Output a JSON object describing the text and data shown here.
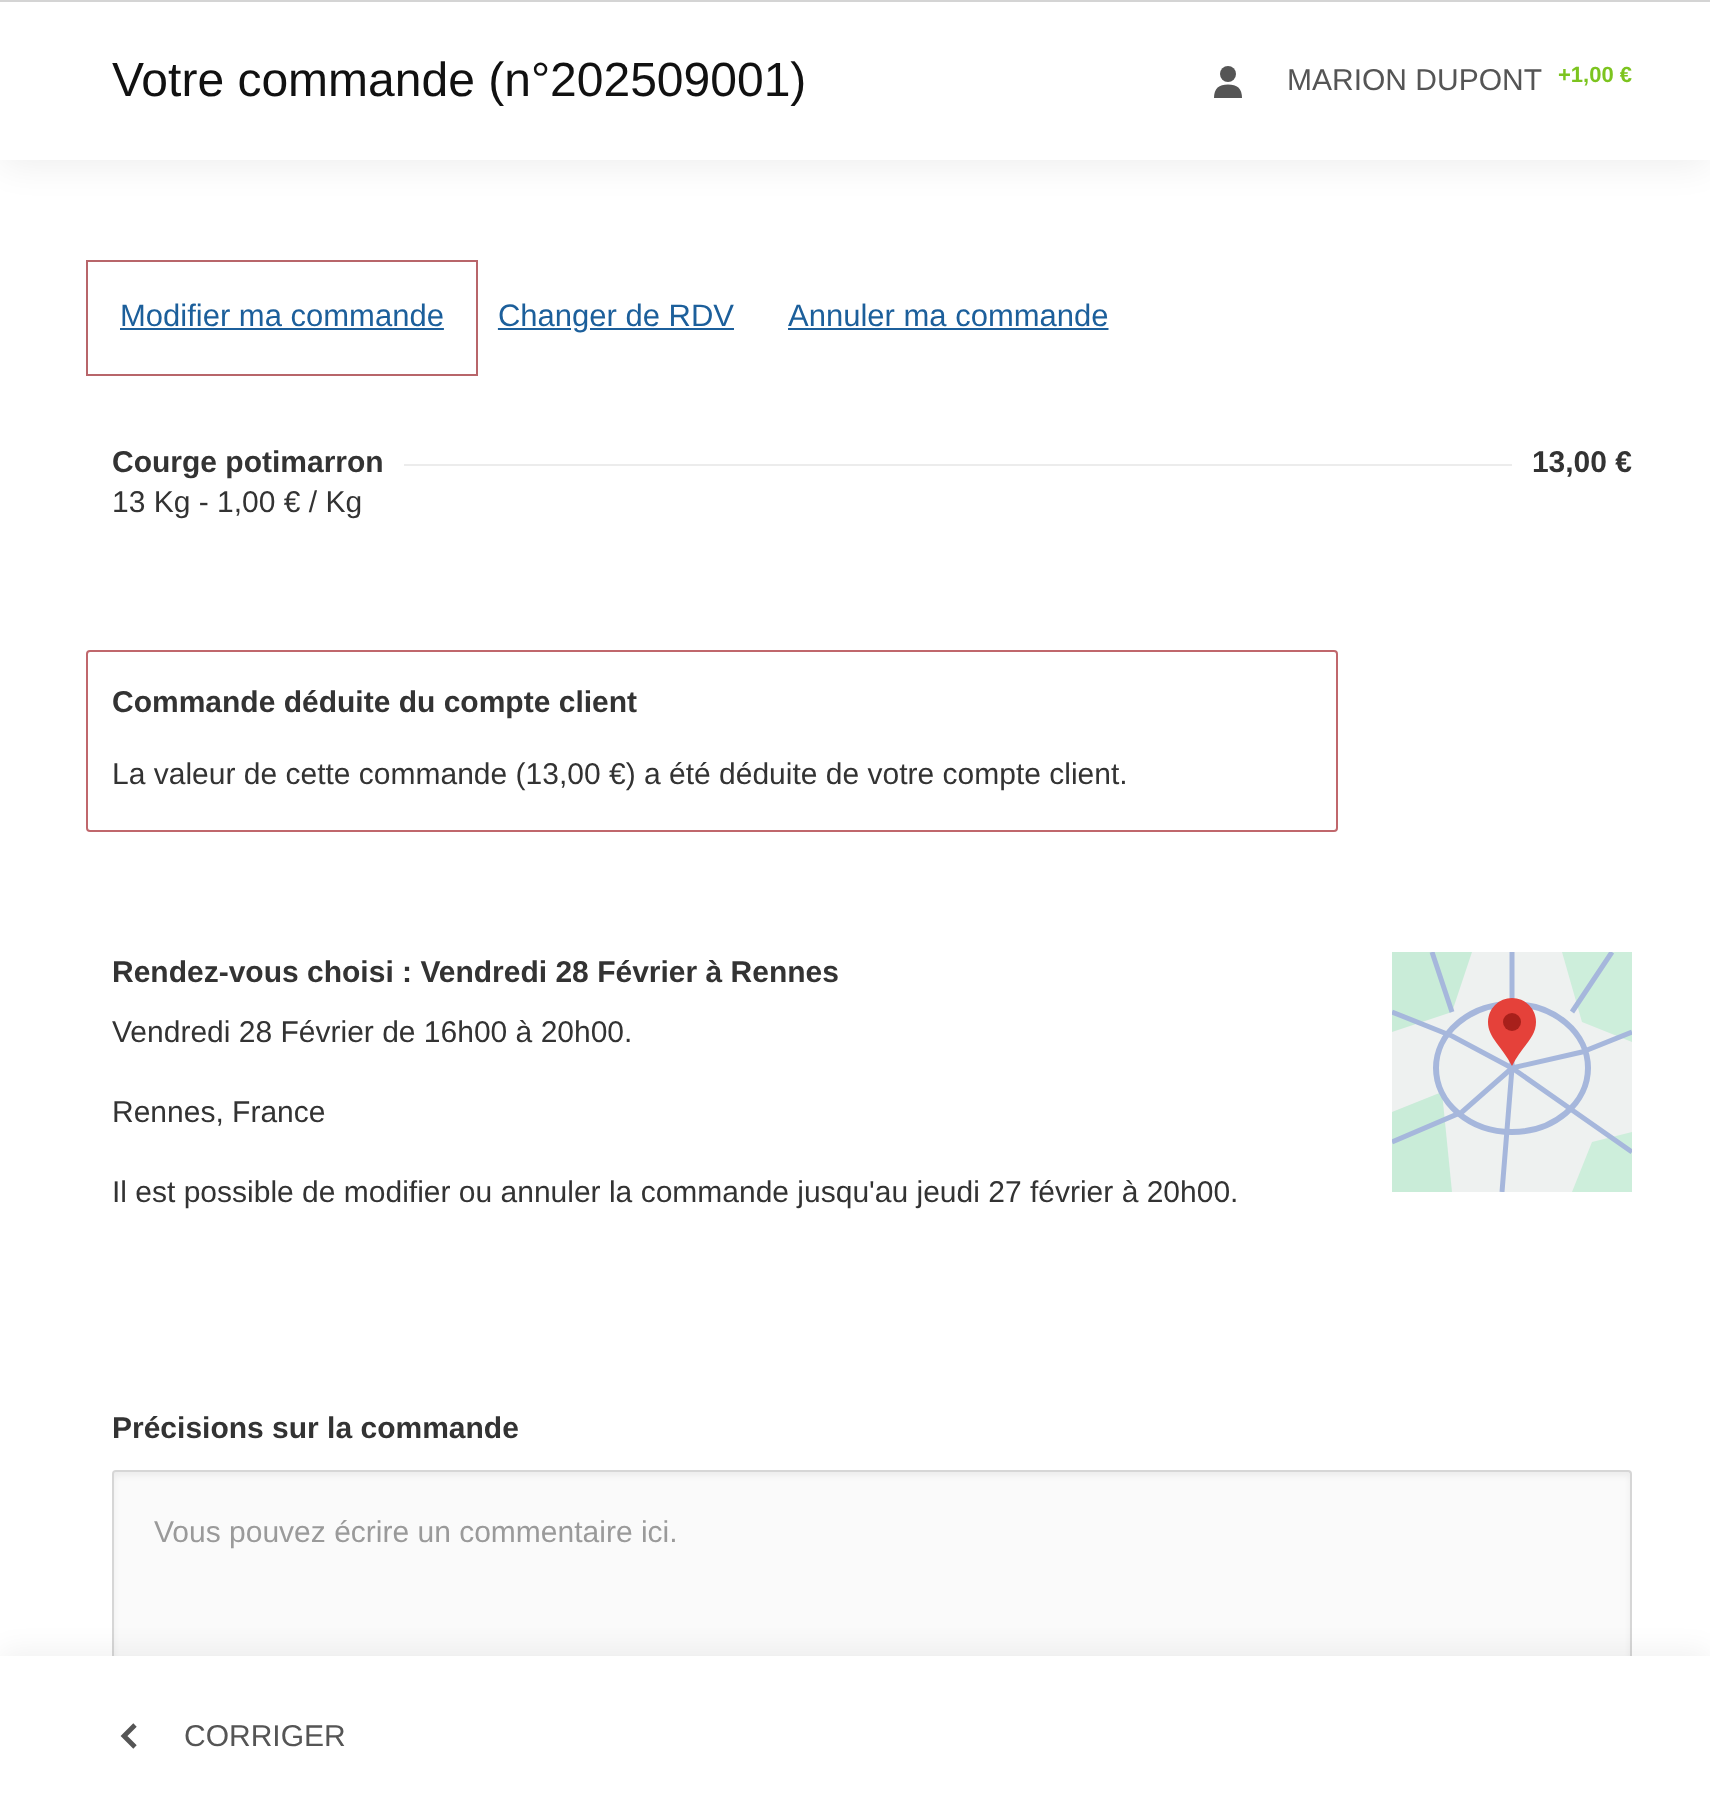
{
  "header": {
    "title": "Votre commande (n°202509001)",
    "user_name": "MARION DUPONT",
    "balance": "+1,00 €"
  },
  "actions": [
    {
      "label": "Modifier ma commande",
      "focused": true
    },
    {
      "label": "Changer de RDV",
      "focused": false
    },
    {
      "label": "Annuler ma commande",
      "focused": false
    }
  ],
  "items": [
    {
      "name": "Courge potimarron",
      "detail": "13 Kg - 1,00 € / Kg",
      "price": "13,00 €"
    }
  ],
  "notice": {
    "title": "Commande déduite du compte client",
    "text": "La valeur de cette commande (13,00 €) a été déduite de votre compte client."
  },
  "appointment": {
    "title": "Rendez-vous choisi : Vendredi 28 Février à Rennes",
    "lines": [
      "Vendredi 28 Février de 16h00 à 20h00.",
      "Rennes, France",
      "Il est possible de modifier ou annuler la commande jusqu'au jeudi 27 février à 20h00."
    ]
  },
  "comment": {
    "label": "Précisions sur la commande",
    "placeholder": "Vous pouvez écrire un commentaire ici."
  },
  "footer": {
    "back_label": "CORRIGER"
  }
}
